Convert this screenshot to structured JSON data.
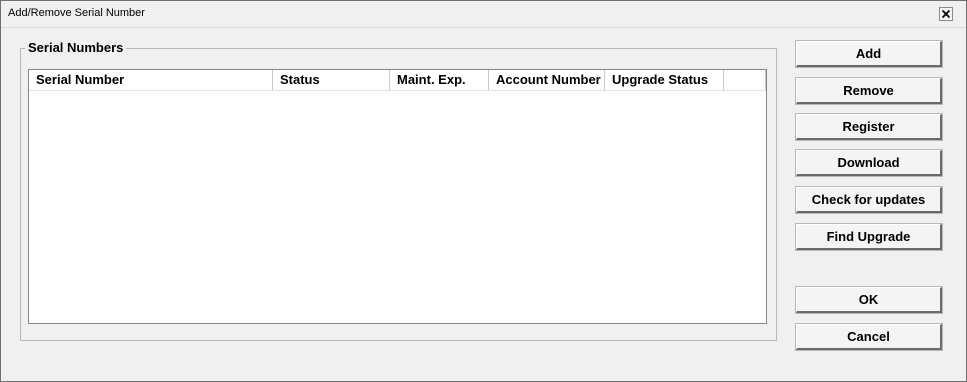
{
  "window": {
    "title": "Add/Remove Serial Number"
  },
  "icons": {
    "close": "close-icon"
  },
  "serial_numbers": {
    "group_label": "Serial Numbers",
    "columns": [
      "Serial Number",
      "Status",
      "Maint. Exp.",
      "Account Number",
      "Upgrade Status",
      ""
    ],
    "rows": []
  },
  "buttons": {
    "add": "Add",
    "remove": "Remove",
    "register": "Register",
    "download": "Download",
    "check_for_updates": "Check for updates",
    "find_upgrade": "Find Upgrade",
    "ok": "OK",
    "cancel": "Cancel"
  }
}
